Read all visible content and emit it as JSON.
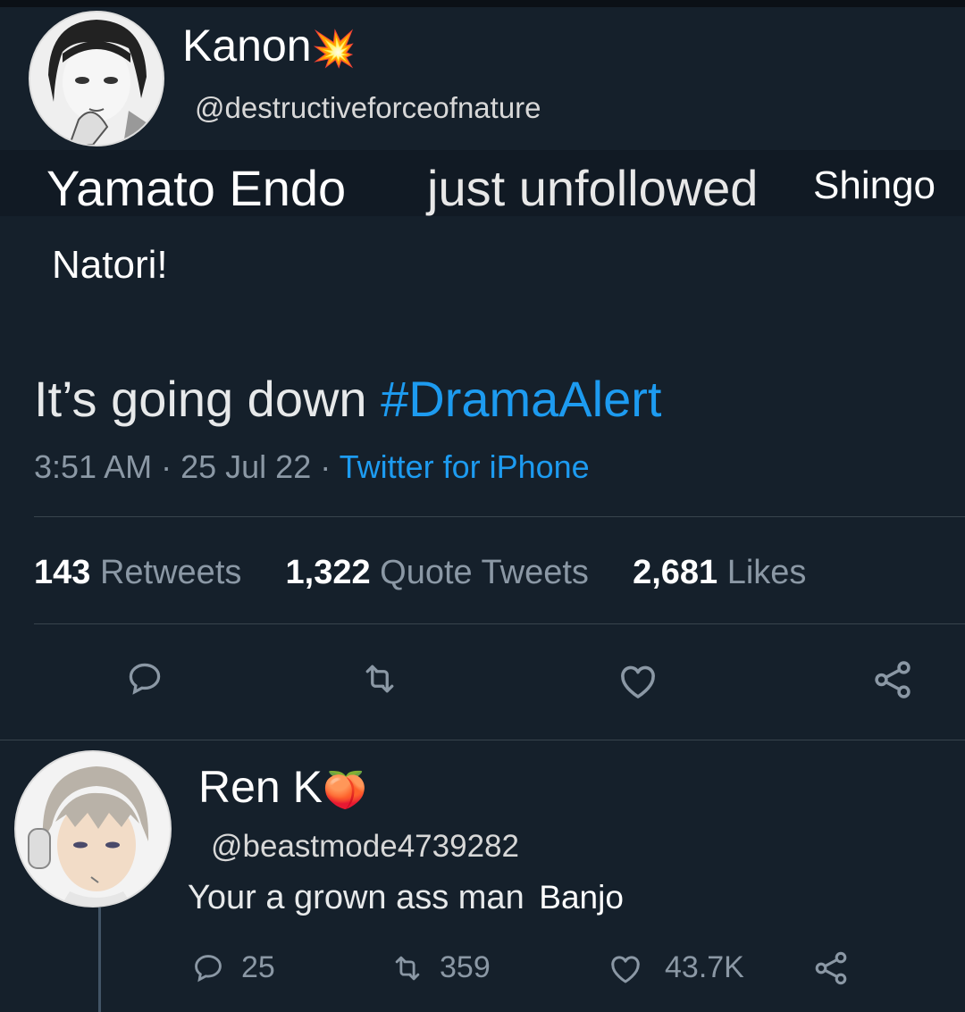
{
  "tweet": {
    "author_name": "Kanon",
    "author_emoji": "💥",
    "author_handle": "@destructiveforceofnature",
    "text_line1_a": "Yamato Endo",
    "text_line1_b": "just unfollowed",
    "text_line1_c": "Shingo",
    "text_line2": "Natori!",
    "text_line3_a": "It’s going down",
    "hashtag": "#DramaAlert",
    "time": "3:51 AM",
    "date": "25 Jul 22",
    "source": "Twitter for iPhone",
    "stats": {
      "retweets_count": "143",
      "retweets_label": "Retweets",
      "quotes_count": "1,322",
      "quotes_label": "Quote Tweets",
      "likes_count": "2,681",
      "likes_label": "Likes"
    }
  },
  "reply": {
    "author_name": "Ren K",
    "author_emoji": "🍑",
    "author_handle": "@beastmode4739282",
    "text_a": "Your a grown ass man",
    "text_b": "Banjo",
    "replies": "25",
    "retweets": "359",
    "likes": "43.7K"
  },
  "colors": {
    "background": "#15202b",
    "link": "#1d9bf0",
    "muted": "#8b98a5",
    "divider": "#38444d"
  }
}
